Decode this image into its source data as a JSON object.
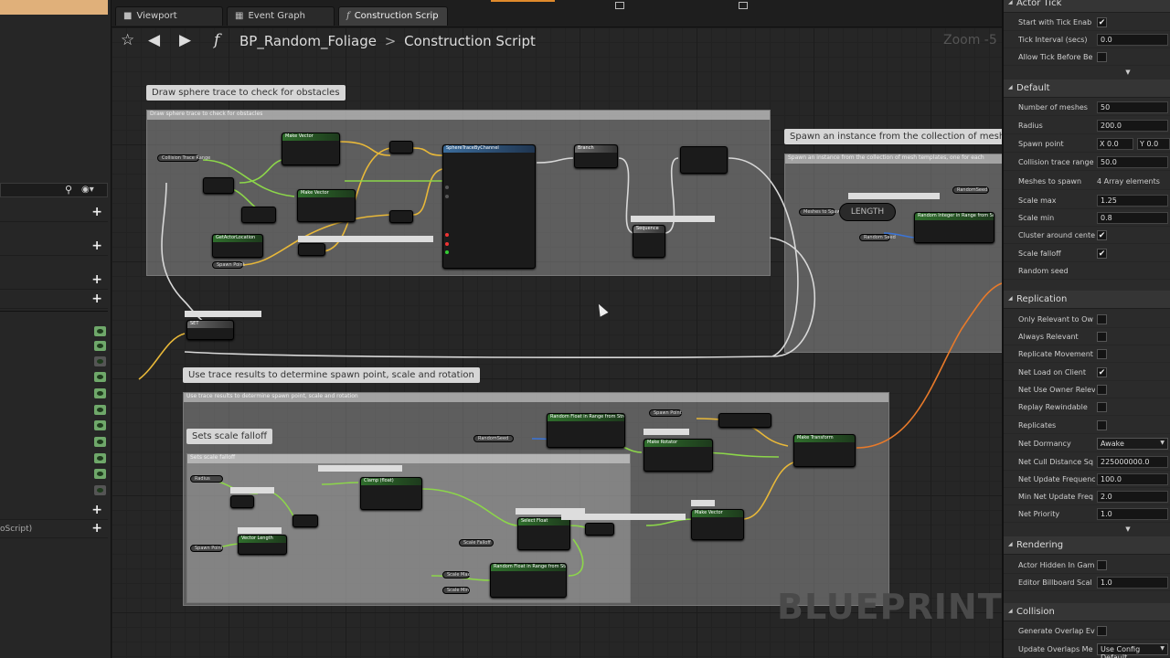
{
  "tabs": [
    {
      "label": "Viewport",
      "icon": "viewport-icon"
    },
    {
      "label": "Event Graph",
      "icon": "event-graph-icon"
    },
    {
      "label": "Construction Scrip",
      "icon": "function-icon"
    }
  ],
  "header": {
    "blueprint": "BP_Random_Foliage",
    "separator": ">",
    "graph": "Construction Script",
    "zoom": "Zoom -5"
  },
  "left_panel": {
    "partial_label": "oScript)"
  },
  "comments": {
    "sphere_trace": "Draw sphere trace to check for obstacles",
    "spawn_instance": "Spawn an instance from the collection of mesh te",
    "trace_results": "Use trace results to determine spawn point, scale and rotation",
    "scale_falloff": "Sets scale falloff"
  },
  "comment_headers": {
    "sphere_trace": "Draw sphere trace to check for obstacles",
    "spawn_instance": "Spawn an instance from the collection of mesh templates, one for each",
    "trace_results": "Use trace results to determine spawn point, scale and rotation",
    "scale_falloff": "Sets scale falloff"
  },
  "graph": {
    "length_node": "LENGTH",
    "watermark": "BLUEPRINT",
    "nodes": {
      "make_vector_1": "Make Vector",
      "make_vector_2": "Make Vector",
      "sphere_trace": "SphereTraceByChannel",
      "branch": "Branch",
      "for_loop": "Sequence",
      "get_actor_location": "GetActorLocation",
      "random_int": "Random Integer in Range from Stream",
      "set_spawn": "SET",
      "random_float_stream": "Random Float in Range from Stream",
      "make_rotator": "Make Rotator",
      "make_transform": "Make Transform",
      "clamp_float": "Clamp (float)",
      "vector_length": "Vector Length",
      "select_float": "Select Float",
      "random_float_2": "Random Float in Range from Stream",
      "make_vector_3": "Make Vector"
    },
    "vars": {
      "collision_trace_range": "Collision Trace Range",
      "spawn_point": "Spawn Point",
      "meshes_to_spawn": "Meshes to Spawn",
      "random_seed": "Random Seed",
      "random_seed_2": "RandomSeed",
      "spawn_point_2": "Spawn Point",
      "scale_falloff": "Scale Falloff",
      "scale_max": "Scale Max",
      "scale_min": "Scale Min",
      "radius": "Radius",
      "random_seed_3": "RandomSeed",
      "spawn_point_3": "Spawn Point"
    }
  },
  "details": {
    "actor_tick": {
      "title": "Actor Tick",
      "start_with_tick": {
        "label": "Start with Tick Enab",
        "checked": "✔"
      },
      "tick_interval": {
        "label": "Tick Interval (secs)",
        "value": "0.0"
      },
      "allow_tick_before": {
        "label": "Allow Tick Before Be",
        "checked": ""
      }
    },
    "default": {
      "title": "Default",
      "number_of_meshes": {
        "label": "Number of meshes",
        "value": "50"
      },
      "radius": {
        "label": "Radius",
        "value": "200.0"
      },
      "spawn_point": {
        "label": "Spawn point",
        "x_label": "X",
        "x_value": "0.0",
        "y_label": "Y",
        "y_value": "0.0"
      },
      "collision_trace_range": {
        "label": "Collision trace range",
        "value": "50.0"
      },
      "meshes_to_spawn": {
        "label": "Meshes to spawn",
        "value": "4 Array elements"
      },
      "scale_max": {
        "label": "Scale max",
        "value": "1.25"
      },
      "scale_min": {
        "label": "Scale min",
        "value": "0.8"
      },
      "cluster_around_center": {
        "label": "Cluster around cente",
        "checked": "✔"
      },
      "scale_falloff": {
        "label": "Scale falloff",
        "checked": "✔"
      },
      "random_seed": {
        "label": "Random seed"
      }
    },
    "replication": {
      "title": "Replication",
      "only_relevant_to_owner": {
        "label": "Only Relevant to Ow",
        "checked": ""
      },
      "always_relevant": {
        "label": "Always Relevant",
        "checked": ""
      },
      "replicate_movement": {
        "label": "Replicate Movement",
        "checked": ""
      },
      "net_load_on_client": {
        "label": "Net Load on Client",
        "checked": "✔"
      },
      "net_use_owner_relevancy": {
        "label": "Net Use Owner Relev",
        "checked": ""
      },
      "replay_rewindable": {
        "label": "Replay Rewindable",
        "checked": ""
      },
      "replicates": {
        "label": "Replicates",
        "checked": ""
      },
      "net_dormancy": {
        "label": "Net Dormancy",
        "value": "Awake"
      },
      "net_cull_distance": {
        "label": "Net Cull Distance Sq",
        "value": "225000000.0"
      },
      "net_update_frequency": {
        "label": "Net Update Frequenc",
        "value": "100.0"
      },
      "min_net_update_freq": {
        "label": "Min Net Update Freq",
        "value": "2.0"
      },
      "net_priority": {
        "label": "Net Priority",
        "value": "1.0"
      }
    },
    "rendering": {
      "title": "Rendering",
      "actor_hidden_in_game": {
        "label": "Actor Hidden In Gam",
        "checked": ""
      },
      "editor_billboard_scale": {
        "label": "Editor Billboard Scal",
        "value": "1.0"
      }
    },
    "collision": {
      "title": "Collision",
      "generate_overlap_events": {
        "label": "Generate Overlap Ev",
        "checked": ""
      },
      "update_overlaps_method": {
        "label": "Update Overlaps Me",
        "value": "Use Config Default"
      }
    }
  },
  "colors": {
    "exec_wire": "#d8d8d8",
    "float_wire": "#8cd64a",
    "vector_wire": "#e8b839",
    "transform_wire": "#e87a2a",
    "struct_wire": "#3a74d8",
    "accent_orange": "#e08a2c"
  }
}
